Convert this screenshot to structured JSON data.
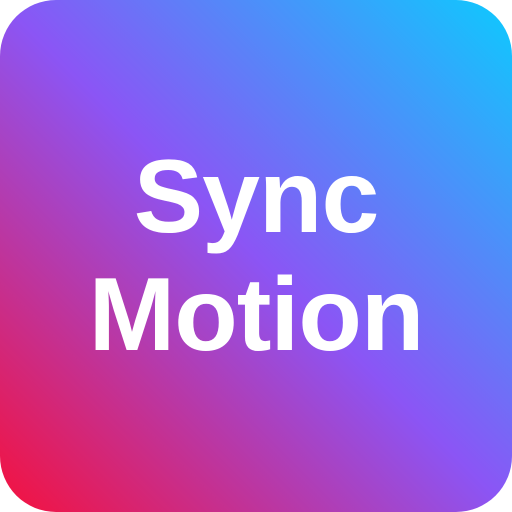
{
  "icon": {
    "line1": "Sync",
    "line2": "Motion",
    "text_color": "#ffffff",
    "gradient": {
      "bottom_left": "#f5113d",
      "middle": "#8b55f5",
      "top_right": "#0dcafe"
    }
  }
}
